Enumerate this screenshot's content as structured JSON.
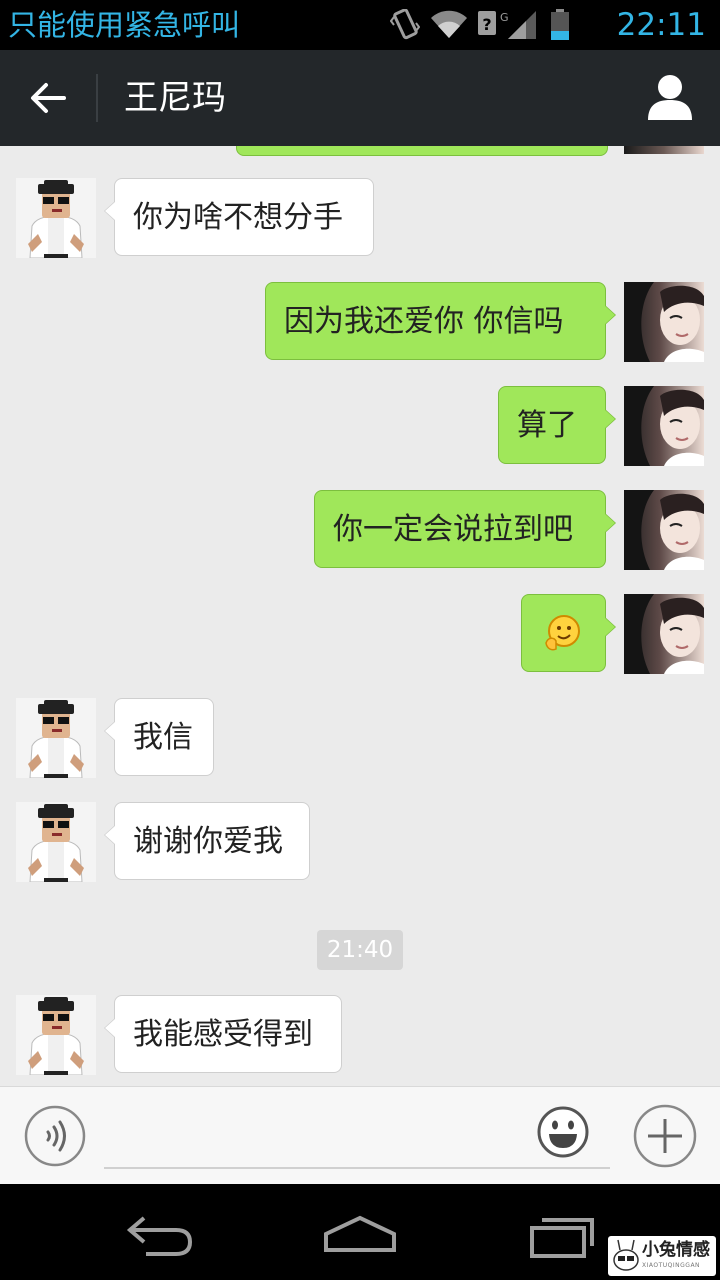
{
  "status_bar": {
    "carrier_text": "只能使用紧急呼叫",
    "time": "22:11",
    "icons": [
      "vibrate-icon",
      "wifi-icon",
      "signal-icon",
      "battery-icon"
    ]
  },
  "header": {
    "title": "王尼玛",
    "back_icon": "back-arrow-icon",
    "profile_icon": "profile-icon"
  },
  "messages": [
    {
      "side": "in",
      "text": "你为啥不想分手"
    },
    {
      "side": "out",
      "text": "因为我还爱你  你信吗"
    },
    {
      "side": "out",
      "text": "算了"
    },
    {
      "side": "out",
      "text": "你一定会说拉到吧"
    },
    {
      "side": "out",
      "emoji": "thinking-face-emoji"
    },
    {
      "side": "in",
      "text": "我信"
    },
    {
      "side": "in",
      "text": "谢谢你爱我"
    },
    {
      "timestamp": "21:40"
    },
    {
      "side": "in",
      "text": "我能感受得到"
    }
  ],
  "input_bar": {
    "text_value": "",
    "icons": [
      "voice-icon",
      "emoji-icon",
      "plus-icon"
    ]
  },
  "nav_bar": {
    "icons": [
      "nav-back-icon",
      "nav-home-icon",
      "nav-recent-apps-icon"
    ]
  },
  "watermark": {
    "title": "小兔情感",
    "subtitle": "XIAOTUQINGGAN"
  },
  "colors": {
    "status_text": "#33b5e5",
    "header_bg": "#23272a",
    "chat_bg": "#ebebeb",
    "outgoing_bubble": "#a0e75a",
    "incoming_bubble": "#ffffff"
  }
}
